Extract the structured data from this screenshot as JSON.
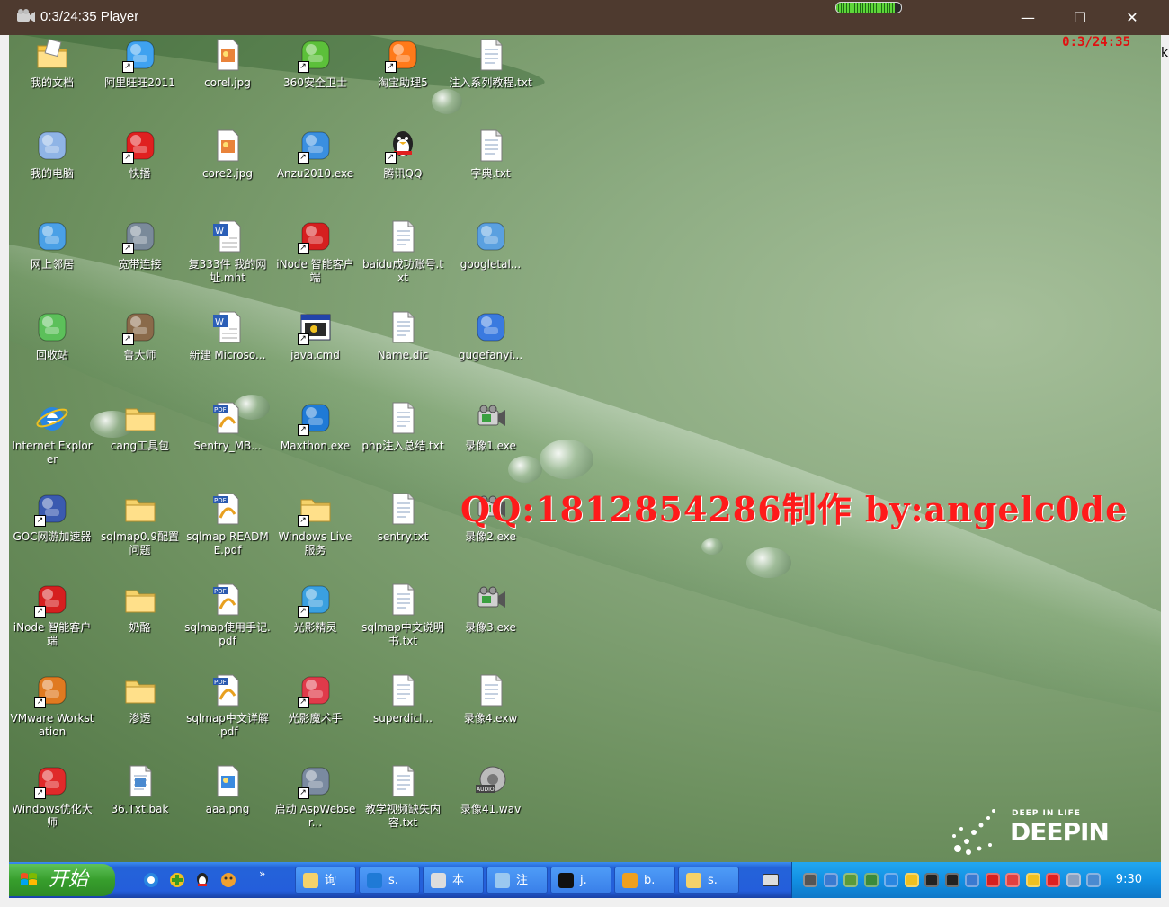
{
  "window": {
    "title": "0:3/24:35 Player",
    "progress_fraction": 0.9,
    "minimize_label": "—",
    "maximize_label": "☐",
    "close_label": "✕",
    "edge_char": "k"
  },
  "video": {
    "timestamp": "0:3/24:35",
    "watermark": "QQ:1812854286制作  by:angelc0de",
    "logo_small": "DEEP IN LIFE",
    "logo_big": "DEEPIN"
  },
  "desktop_icons": [
    {
      "label": "我的文档",
      "icon": "folder-documents-icon",
      "shortcut": false,
      "color": "#f5c542"
    },
    {
      "label": "阿里旺旺2011",
      "icon": "aliwangwang-icon",
      "shortcut": true,
      "color": "#3fa2f0"
    },
    {
      "label": "corel.jpg",
      "icon": "image-file-icon",
      "shortcut": false,
      "color": "#e9833a"
    },
    {
      "label": "360安全卫士",
      "icon": "360-safe-icon",
      "shortcut": true,
      "color": "#5cc03a"
    },
    {
      "label": "淘宝助理5",
      "icon": "taobao-icon",
      "shortcut": true,
      "color": "#ff7a1a"
    },
    {
      "label": "注入系列教程.txt",
      "icon": "text-file-icon",
      "shortcut": false,
      "color": "#ffffff"
    },
    {
      "label": "我的电脑",
      "icon": "my-computer-icon",
      "shortcut": false,
      "color": "#8fb4e6"
    },
    {
      "label": "快播",
      "icon": "qvod-icon",
      "shortcut": true,
      "color": "#e02020"
    },
    {
      "label": "core2.jpg",
      "icon": "image-file-icon",
      "shortcut": false,
      "color": "#e9833a"
    },
    {
      "label": "Anzu2010.exe",
      "icon": "anzu-icon",
      "shortcut": true,
      "color": "#3a8fe0"
    },
    {
      "label": "腾讯QQ",
      "icon": "qq-penguin-icon",
      "shortcut": true,
      "color": "#222222"
    },
    {
      "label": "字典.txt",
      "icon": "text-file-icon",
      "shortcut": false,
      "color": "#ffffff"
    },
    {
      "label": "网上邻居",
      "icon": "network-places-icon",
      "shortcut": false,
      "color": "#4aa0e6"
    },
    {
      "label": "宽带连接",
      "icon": "broadband-icon",
      "shortcut": true,
      "color": "#7a8a9a"
    },
    {
      "label": "复333件 我的网址.mht",
      "icon": "word-document-icon",
      "shortcut": false,
      "color": "#2b5fb8"
    },
    {
      "label": "iNode 智能客户端",
      "icon": "inode-icon",
      "shortcut": true,
      "color": "#d61f1f"
    },
    {
      "label": "baidu成功账号.txt",
      "icon": "text-file-icon",
      "shortcut": false,
      "color": "#ffffff"
    },
    {
      "label": "googletal...",
      "icon": "google-talk-icon",
      "shortcut": false,
      "color": "#5aa0e0"
    },
    {
      "label": "回收站",
      "icon": "recycle-bin-icon",
      "shortcut": false,
      "color": "#5cc05a"
    },
    {
      "label": "鲁大师",
      "icon": "ludashi-icon",
      "shortcut": true,
      "color": "#8a6a4a"
    },
    {
      "label": "新建 Microso...",
      "icon": "word-document-icon",
      "shortcut": false,
      "color": "#2b5fb8"
    },
    {
      "label": "java.cmd",
      "icon": "cmd-script-icon",
      "shortcut": true,
      "color": "#2a2a2a"
    },
    {
      "label": "Name.dic",
      "icon": "text-file-icon",
      "shortcut": false,
      "color": "#ffffff"
    },
    {
      "label": "gugefanyi...",
      "icon": "google-translate-icon",
      "shortcut": false,
      "color": "#3a7ae0"
    },
    {
      "label": "Internet Explorer",
      "icon": "internet-explorer-icon",
      "shortcut": false,
      "color": "#2a86e0"
    },
    {
      "label": "cang工具包",
      "icon": "folder-icon",
      "shortcut": false,
      "color": "#f5d26a"
    },
    {
      "label": "Sentry_MB...",
      "icon": "pdf-file-icon",
      "shortcut": false,
      "color": "#e04040"
    },
    {
      "label": "Maxthon.exe",
      "icon": "maxthon-icon",
      "shortcut": true,
      "color": "#1f7ad6"
    },
    {
      "label": "php注入总结.txt",
      "icon": "text-file-icon",
      "shortcut": false,
      "color": "#ffffff"
    },
    {
      "label": "录像1.exe",
      "icon": "video-recorder-icon",
      "shortcut": false,
      "color": "#666666"
    },
    {
      "label": "GOC网游加速器",
      "icon": "goc-accelerator-icon",
      "shortcut": true,
      "color": "#3a5ab0"
    },
    {
      "label": "sqlmap0.9配置问题",
      "icon": "folder-icon",
      "shortcut": false,
      "color": "#f5d26a"
    },
    {
      "label": "sqlmap README.pdf",
      "icon": "pdf-file-icon",
      "shortcut": false,
      "color": "#e04040"
    },
    {
      "label": "Windows Live 服务",
      "icon": "folder-icon",
      "shortcut": true,
      "color": "#f5d26a"
    },
    {
      "label": "sentry.txt",
      "icon": "text-file-icon",
      "shortcut": false,
      "color": "#ffffff"
    },
    {
      "label": "录像2.exe",
      "icon": "video-recorder-icon",
      "shortcut": false,
      "color": "#666666"
    },
    {
      "label": "iNode 智能客户端",
      "icon": "inode-icon",
      "shortcut": true,
      "color": "#d61f1f"
    },
    {
      "label": "奶酪",
      "icon": "folder-icon",
      "shortcut": false,
      "color": "#f5d26a"
    },
    {
      "label": "sqlmap使用手记.pdf",
      "icon": "pdf-file-icon",
      "shortcut": false,
      "color": "#e04040"
    },
    {
      "label": "光影精灵",
      "icon": "photo-elf-icon",
      "shortcut": true,
      "color": "#3aa0e0"
    },
    {
      "label": "sqlmap中文说明书.txt",
      "icon": "text-file-icon",
      "shortcut": false,
      "color": "#ffffff"
    },
    {
      "label": "录像3.exe",
      "icon": "video-recorder-icon",
      "shortcut": false,
      "color": "#666666"
    },
    {
      "label": "VMware Workstation",
      "icon": "vmware-icon",
      "shortcut": true,
      "color": "#e07a20"
    },
    {
      "label": "渗透",
      "icon": "folder-icon",
      "shortcut": false,
      "color": "#f5d26a"
    },
    {
      "label": "sqlmap中文详解 .pdf",
      "icon": "pdf-file-icon",
      "shortcut": false,
      "color": "#e04040"
    },
    {
      "label": "光影魔术手",
      "icon": "nEO-imaging-icon",
      "shortcut": true,
      "color": "#e03a4a"
    },
    {
      "label": "superdicl...",
      "icon": "text-file-icon",
      "shortcut": false,
      "color": "#ffffff"
    },
    {
      "label": "录像4.exw",
      "icon": "unknown-file-icon",
      "shortcut": false,
      "color": "#ffffff"
    },
    {
      "label": "Windows优化大师",
      "icon": "windows-optimizer-icon",
      "shortcut": true,
      "color": "#e02a2a"
    },
    {
      "label": "36.Txt.bak",
      "icon": "backup-file-icon",
      "shortcut": false,
      "color": "#4a8ad0"
    },
    {
      "label": "aaa.png",
      "icon": "image-file-icon",
      "shortcut": false,
      "color": "#3a8ae0"
    },
    {
      "label": "启动 AspWebser...",
      "icon": "aspwebserver-icon",
      "shortcut": true,
      "color": "#7a8aa0"
    },
    {
      "label": "教学视频缺失内容.txt",
      "icon": "text-file-icon",
      "shortcut": false,
      "color": "#ffffff"
    },
    {
      "label": "录像41.wav",
      "icon": "audio-file-icon",
      "shortcut": false,
      "color": "#888888"
    }
  ],
  "taskbar": {
    "start_label": "开始",
    "quicklaunch_more": "»",
    "buttons": [
      {
        "label": "询",
        "icon": "folder-icon",
        "color": "#f5d26a"
      },
      {
        "label": "s.",
        "icon": "maxthon-icon",
        "color": "#1f7ad6"
      },
      {
        "label": "本",
        "icon": "ship-icon",
        "color": "#dddddd"
      },
      {
        "label": "注",
        "icon": "notepad-icon",
        "color": "#9ac8f0"
      },
      {
        "label": "j.",
        "icon": "cmd-icon",
        "color": "#111111"
      },
      {
        "label": "b.",
        "icon": "lightning-icon",
        "color": "#f0a020"
      },
      {
        "label": "s.",
        "icon": "folder-icon",
        "color": "#f5d26a"
      }
    ],
    "clock": "9:30"
  }
}
